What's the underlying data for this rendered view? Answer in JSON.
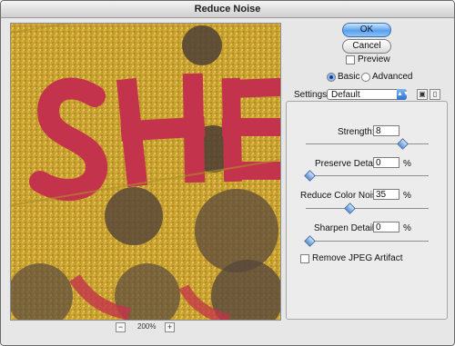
{
  "window": {
    "title": "Reduce Noise"
  },
  "preview": {
    "zoom": "200%",
    "zoom_out_label": "−",
    "zoom_in_label": "+"
  },
  "buttons": {
    "ok": "OK",
    "cancel": "Cancel"
  },
  "preview_checkbox": {
    "label": "Preview",
    "checked": false
  },
  "mode": {
    "basic_label": "Basic",
    "advanced_label": "Advanced",
    "selected": "Basic"
  },
  "settings": {
    "label": "Settings:",
    "value": "Default"
  },
  "controls": {
    "strength": {
      "label": "Strength:",
      "value": "8",
      "unit": "",
      "slider_fraction": 0.8
    },
    "preserve_details": {
      "label": "Preserve Details:",
      "value": "0",
      "unit": "%",
      "slider_fraction": 0.0
    },
    "reduce_color_noise": {
      "label": "Reduce Color Noise:",
      "value": "35",
      "unit": "%",
      "slider_fraction": 0.35
    },
    "sharpen_details": {
      "label": "Sharpen Details:",
      "value": "0",
      "unit": "%",
      "slider_fraction": 0.0
    }
  },
  "jpeg_checkbox": {
    "label": "Remove JPEG Artifact",
    "checked": false
  },
  "icons": {
    "dropdown": "chevron-updown-icon",
    "save_settings": "disk-icon",
    "delete_settings": "trash-icon"
  }
}
